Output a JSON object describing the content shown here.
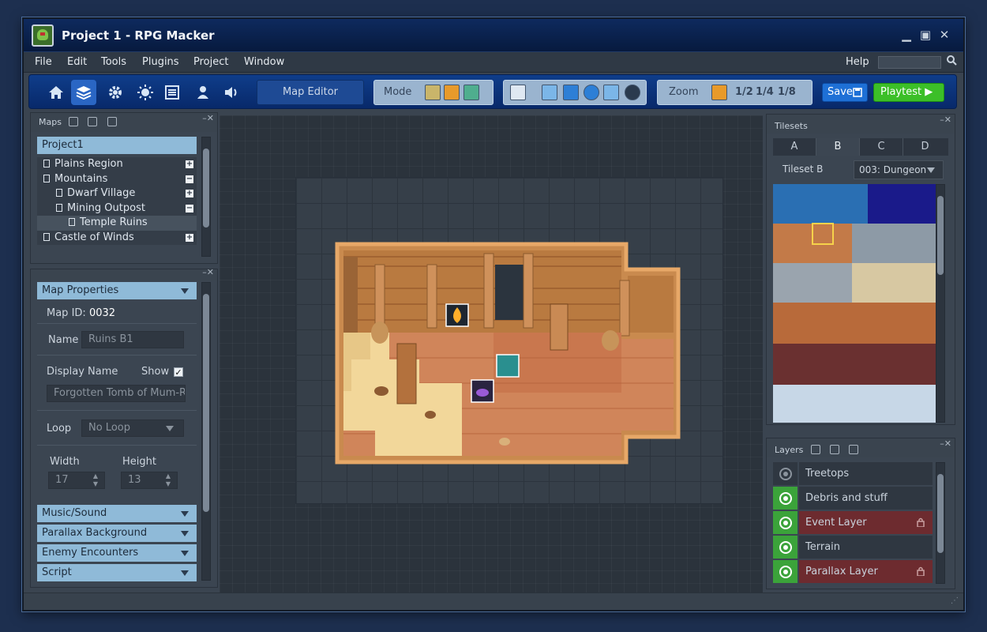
{
  "window": {
    "title": "Project 1 - RPG Macker"
  },
  "menu": {
    "items": [
      "File",
      "Edit",
      "Tools",
      "Plugins",
      "Project",
      "Window"
    ],
    "help": "Help"
  },
  "toolbar": {
    "active_tool": "map-editor",
    "label": "Map Editor",
    "mode_label": "Mode",
    "zoom_label": "Zoom",
    "zoom_levels": [
      "1/2",
      "1/4",
      "1/8"
    ],
    "save_label": "Save",
    "playtest_label": "Playtest ▶",
    "accent_blue": "#1e70d6",
    "accent_green": "#3cbf28"
  },
  "maps": {
    "title": "Maps",
    "root": "Project1",
    "items": [
      {
        "label": "Plains Region",
        "expander": "+"
      },
      {
        "label": "Mountains",
        "expander": "−"
      },
      {
        "label": "Dwarf Village",
        "expander": "+"
      },
      {
        "label": "Mining Outpost",
        "expander": "−"
      },
      {
        "label": "Temple Ruins",
        "expander": ""
      },
      {
        "label": "Castle of Winds",
        "expander": "+"
      }
    ]
  },
  "props": {
    "section": "Map Properties",
    "map_id_label": "Map ID:",
    "map_id": "0032",
    "name_label": "Name",
    "name_value": "Ruins B1",
    "display_name_label": "Display Name",
    "show_label": "Show",
    "show_check": "✓",
    "display_name_value": "Forgotten Tomb of Mum-Ra",
    "loop_label": "Loop",
    "loop_value": "No Loop",
    "width_label": "Width",
    "width_value": "17",
    "height_label": "Height",
    "height_value": "13",
    "sections": [
      "Music/Sound",
      "Parallax Background",
      "Enemy Encounters",
      "Script"
    ]
  },
  "tilesets": {
    "title": "Tilesets",
    "tabs": [
      "A",
      "B",
      "C",
      "D"
    ],
    "active_tab": "B",
    "selector_label": "Tileset B",
    "selector_value": "003: Dungeon"
  },
  "layers": {
    "title": "Layers",
    "items": [
      {
        "name": "Treetops",
        "visible": false,
        "locked": false
      },
      {
        "name": "Debris and stuff",
        "visible": true,
        "locked": false
      },
      {
        "name": "Event Layer",
        "visible": true,
        "locked": true
      },
      {
        "name": "Terrain",
        "visible": true,
        "locked": false
      },
      {
        "name": "Parallax Layer",
        "visible": true,
        "locked": true
      }
    ]
  }
}
